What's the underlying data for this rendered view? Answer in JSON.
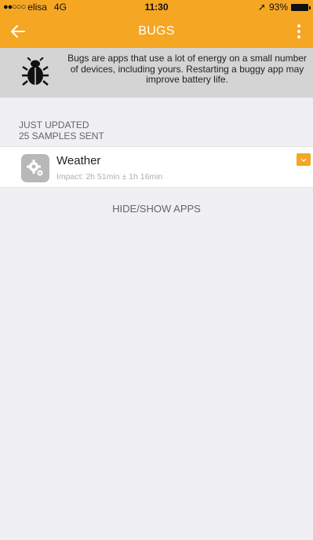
{
  "status_bar": {
    "signal_dots": "●●○○○",
    "carrier": "elisa",
    "network": "4G",
    "time": "11:30",
    "location_glyph": "➚",
    "battery": "93%"
  },
  "nav": {
    "back_icon": "arrow-left-icon",
    "title": "BUGS",
    "menu_icon": "more-vertical-icon"
  },
  "banner": {
    "icon": "bug-icon",
    "text": "Bugs are apps that use a lot of energy on a small number of devices, including yours. Restarting a buggy app may improve battery life."
  },
  "section": {
    "line1": "JUST UPDATED",
    "line2": "25 SAMPLES SENT"
  },
  "apps": [
    {
      "name": "Weather",
      "impact": "Impact: 2h 51min ± 1h 16min",
      "icon": "gears-icon"
    }
  ],
  "hide_show_label": "HIDE/SHOW APPS",
  "colors": {
    "accent": "#f5a623",
    "banner": "#d4d4d4",
    "background": "#efeff4"
  }
}
